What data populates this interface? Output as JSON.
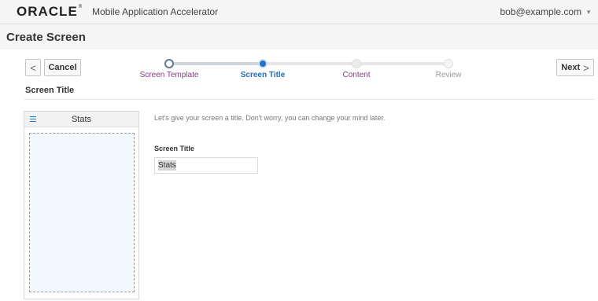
{
  "header": {
    "logo_text": "ORACLE",
    "logo_mark": "®",
    "app_title": "Mobile Application Accelerator",
    "user_email": "bob@example.com",
    "user_menu_icon": "caret-down-icon"
  },
  "page": {
    "title": "Create Screen"
  },
  "toolbar": {
    "back_icon": "chevron-left-icon",
    "back_glyph": "<",
    "cancel_label": "Cancel",
    "next_label": "Next",
    "next_icon": "chevron-right-icon",
    "next_glyph": ">"
  },
  "stepper": {
    "current_step": 2,
    "steps": [
      {
        "label": "Screen Template",
        "state": "completed"
      },
      {
        "label": "Screen Title",
        "state": "current"
      },
      {
        "label": "Content",
        "state": "pending"
      },
      {
        "label": "Review",
        "state": "disabled"
      }
    ]
  },
  "section": {
    "title": "Screen Title"
  },
  "preview": {
    "menu_icon": "hamburger-menu-icon",
    "title": "Stats"
  },
  "form": {
    "intro": "Let's give your screen a title. Don't worry, you can change your mind later.",
    "screen_title_label": "Screen Title",
    "screen_title_value": "Stats"
  },
  "colors": {
    "accent": "#1f74c9",
    "step_link": "#8a3a8a",
    "step_disabled": "#999999"
  }
}
